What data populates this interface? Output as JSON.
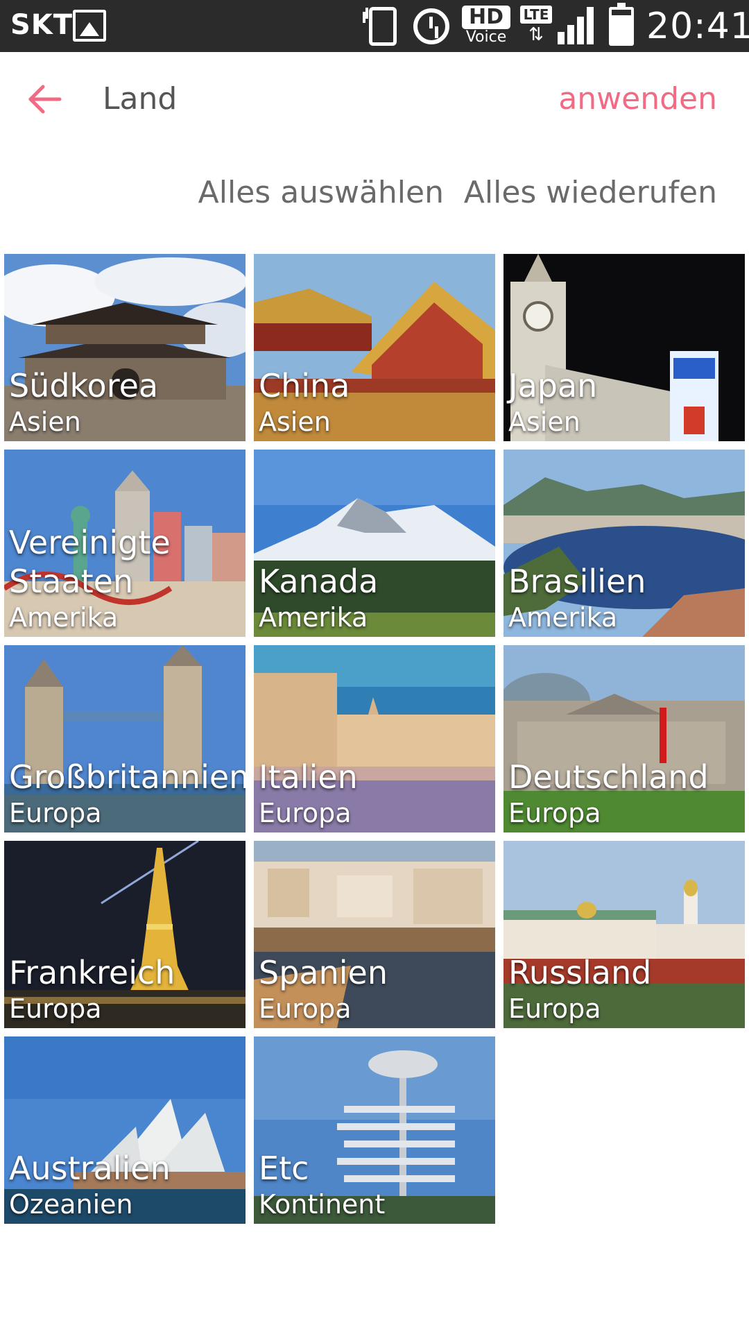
{
  "status_bar": {
    "carrier": "SKT",
    "hd_label": "HD",
    "voice_label": "Voice",
    "lte_label": "LTE",
    "lte_arrows": "⇅",
    "time": "20:41",
    "icons": [
      "gallery-icon",
      "vibrate-icon",
      "alarm-icon",
      "hd-voice-icon",
      "lte-icon",
      "signal-icon",
      "battery-icon"
    ]
  },
  "app_bar": {
    "back_icon": "arrow-left-icon",
    "title": "Land",
    "apply_label": "anwenden",
    "accent_color": "#f26b85"
  },
  "actions": {
    "select_all": "Alles auswählen",
    "revoke_all": "Alles wiederufen"
  },
  "tiles": [
    {
      "name": "Südkorea",
      "continent": "Asien"
    },
    {
      "name": "China",
      "continent": "Asien"
    },
    {
      "name": "Japan",
      "continent": "Asien"
    },
    {
      "name": "Vereinigte\nStaaten",
      "continent": "Amerika"
    },
    {
      "name": "Kanada",
      "continent": "Amerika"
    },
    {
      "name": "Brasilien",
      "continent": "Amerika"
    },
    {
      "name": "Großbritannien",
      "continent": "Europa"
    },
    {
      "name": "Italien",
      "continent": "Europa"
    },
    {
      "name": "Deutschland",
      "continent": "Europa"
    },
    {
      "name": "Frankreich",
      "continent": "Europa"
    },
    {
      "name": "Spanien",
      "continent": "Europa"
    },
    {
      "name": "Russland",
      "continent": "Europa"
    },
    {
      "name": "Australien",
      "continent": "Ozeanien"
    },
    {
      "name": "Etc",
      "continent": "Kontinent"
    }
  ]
}
